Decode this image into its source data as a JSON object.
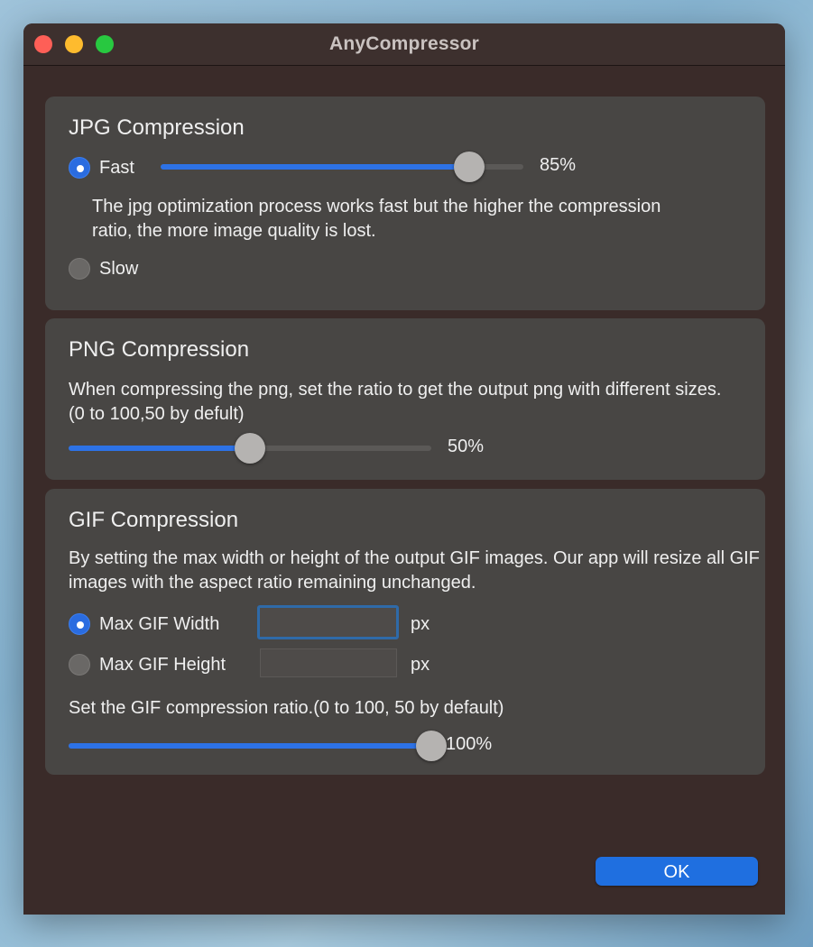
{
  "window": {
    "title": "AnyCompressor"
  },
  "jpg": {
    "heading": "JPG Compression",
    "fast_label": "Fast",
    "fast_selected": true,
    "slider_value": 85,
    "slider_text": "85%",
    "description": "The jpg optimization process works fast but the higher the compression ratio, the more image quality is lost.",
    "slow_label": "Slow",
    "slow_selected": false
  },
  "png": {
    "heading": "PNG Compression",
    "description": "When compressing the png, set the ratio to get the output png with different sizes. (0 to 100,50 by defult)",
    "slider_value": 50,
    "slider_text": "50%"
  },
  "gif": {
    "heading": "GIF Compression",
    "description": "By setting the max width or height of the output GIF images. Our app will resize all GIF images with the aspect ratio remaining unchanged.",
    "max_width_label": "Max GIF Width",
    "max_width_selected": true,
    "max_width_value": "",
    "max_height_label": "Max GIF Height",
    "max_height_selected": false,
    "max_height_value": "",
    "unit": "px",
    "ratio_label": "Set the GIF compression ratio.(0 to 100, 50 by default)",
    "slider_value": 100,
    "slider_text": "100%"
  },
  "buttons": {
    "ok": "OK"
  },
  "colors": {
    "accent": "#2d72e6",
    "panel": "#484644",
    "window": "#3a2b29"
  },
  "icons": {
    "close": "close-dot-icon",
    "minimize": "minimize-dot-icon",
    "zoom": "zoom-dot-icon"
  }
}
